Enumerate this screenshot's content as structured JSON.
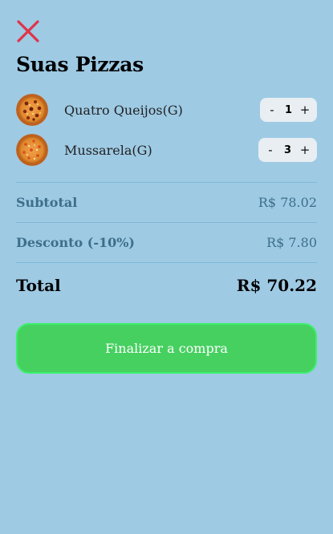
{
  "header": {
    "close_icon": "close-icon",
    "close_color": "#e0334a",
    "title": "Suas Pizzas"
  },
  "cart": {
    "items": [
      {
        "name": "Quatro Queijos(G)",
        "quantity": "1",
        "decrement_label": "-",
        "increment_label": "+",
        "image_icon": "pizza-icon"
      },
      {
        "name": "Mussarela(G)",
        "quantity": "3",
        "decrement_label": "-",
        "increment_label": "+",
        "image_icon": "pizza-icon"
      }
    ]
  },
  "summary": {
    "subtotal_label": "Subtotal",
    "subtotal_value": "R$ 78.02",
    "discount_label": "Desconto (-10%)",
    "discount_value": "R$ 7.80",
    "total_label": "Total",
    "total_value": "R$ 70.22"
  },
  "checkout": {
    "label": "Finalizar a compra",
    "color": "#46d060"
  },
  "colors": {
    "background": "#9ecae4",
    "muted_text": "#3d6e8a"
  }
}
